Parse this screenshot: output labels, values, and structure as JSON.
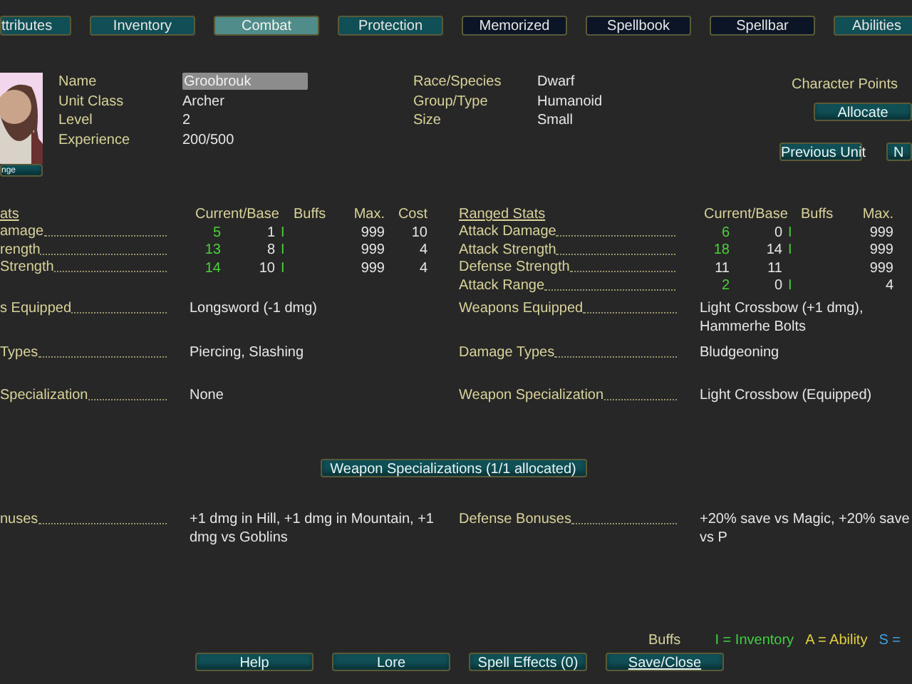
{
  "tabs": [
    {
      "label": "ttributes",
      "kind": "unit",
      "selected": false
    },
    {
      "label": "Inventory",
      "kind": "unit",
      "selected": false
    },
    {
      "label": "Combat",
      "kind": "unit",
      "selected": true
    },
    {
      "label": "Protection",
      "kind": "unit",
      "selected": false
    },
    {
      "label": "Memorized",
      "kind": "spell",
      "selected": false
    },
    {
      "label": "Spellbook",
      "kind": "spell",
      "selected": false
    },
    {
      "label": "Spellbar",
      "kind": "spell",
      "selected": false
    },
    {
      "label": "Abilities",
      "kind": "unit",
      "selected": false
    }
  ],
  "portrait": {
    "button": "nge"
  },
  "info_left": [
    {
      "label": "Name",
      "value": "Groobrouk",
      "kind": "field"
    },
    {
      "label": "Unit Class",
      "value": "Archer",
      "kind": "text"
    },
    {
      "label": "Level",
      "value": "2",
      "kind": "text"
    },
    {
      "label": "Experience",
      "value": "200/500",
      "kind": "text"
    }
  ],
  "info_right": [
    {
      "label": "Race/Species",
      "value": "Dwarf"
    },
    {
      "label": "Group/Type",
      "value": "Humanoid"
    },
    {
      "label": "Size",
      "value": "Small"
    }
  ],
  "character_points": {
    "label": "Character Points",
    "button": "Allocate"
  },
  "unit_nav": [
    "Previous Unit",
    "N"
  ],
  "melee_stats": {
    "title": "ats",
    "headers": [
      "Current/Base",
      "Buffs",
      "Max.",
      "Cost"
    ],
    "rows": [
      {
        "label": "amage",
        "current": "5",
        "base": "1",
        "buff": "I",
        "max": "999",
        "cost": "10",
        "boosted": true
      },
      {
        "label": "rength",
        "current": "13",
        "base": "8",
        "buff": "I",
        "max": "999",
        "cost": "4",
        "boosted": true
      },
      {
        "label": "Strength",
        "current": "14",
        "base": "10",
        "buff": "I",
        "max": "999",
        "cost": "4",
        "boosted": true
      }
    ]
  },
  "ranged_stats": {
    "title": "Ranged Stats",
    "headers": [
      "Current/Base",
      "Buffs",
      "Max."
    ],
    "rows": [
      {
        "label": "Attack Damage",
        "current": "6",
        "base": "0",
        "buff": "I",
        "max": "999",
        "boosted": true
      },
      {
        "label": "Attack Strength",
        "current": "18",
        "base": "14",
        "buff": "I",
        "max": "999",
        "boosted": true
      },
      {
        "label": "Defense Strength",
        "current": "11",
        "base": "11",
        "max": "999",
        "boosted": false
      },
      {
        "label": "Attack Range",
        "current": "2",
        "base": "0",
        "buff": "I",
        "max": "4",
        "boosted": true
      }
    ]
  },
  "details": [
    {
      "left_label": "s Equipped",
      "left_value": "Longsword (-1 dmg)",
      "right_label": "Weapons Equipped",
      "right_value": "Light Crossbow (+1 dmg), Hammerhe Bolts"
    },
    {
      "left_label": "Types",
      "left_value": "Piercing, Slashing",
      "right_label": "Damage Types",
      "right_value": "Bludgeoning"
    },
    {
      "left_label": "Specialization",
      "left_value": "None",
      "right_label": "Weapon Specialization",
      "right_value": "Light Crossbow (Equipped)"
    }
  ],
  "specializations_button": "Weapon Specializations (1/1 allocated)",
  "bonuses": {
    "left_label": "nuses",
    "left_value": "+1 dmg in Hill, +1 dmg in Mountain, +1 dmg vs Goblins",
    "right_label": "Defense Bonuses",
    "right_value": "+20% save vs Magic, +20% save vs P"
  },
  "legend": {
    "title": "Buffs",
    "items": [
      {
        "text": "I = Inventory",
        "color": "#3fcf3f"
      },
      {
        "text": "A = Ability",
        "color": "#e0d040"
      },
      {
        "text": "S =",
        "color": "#3fa0e0"
      }
    ]
  },
  "buttons": [
    {
      "label": "Help",
      "underline": false
    },
    {
      "label": "Lore",
      "underline": false
    },
    {
      "label": "Spell Effects (0)",
      "underline": false
    },
    {
      "label": "Save/Close",
      "underline": true
    }
  ]
}
